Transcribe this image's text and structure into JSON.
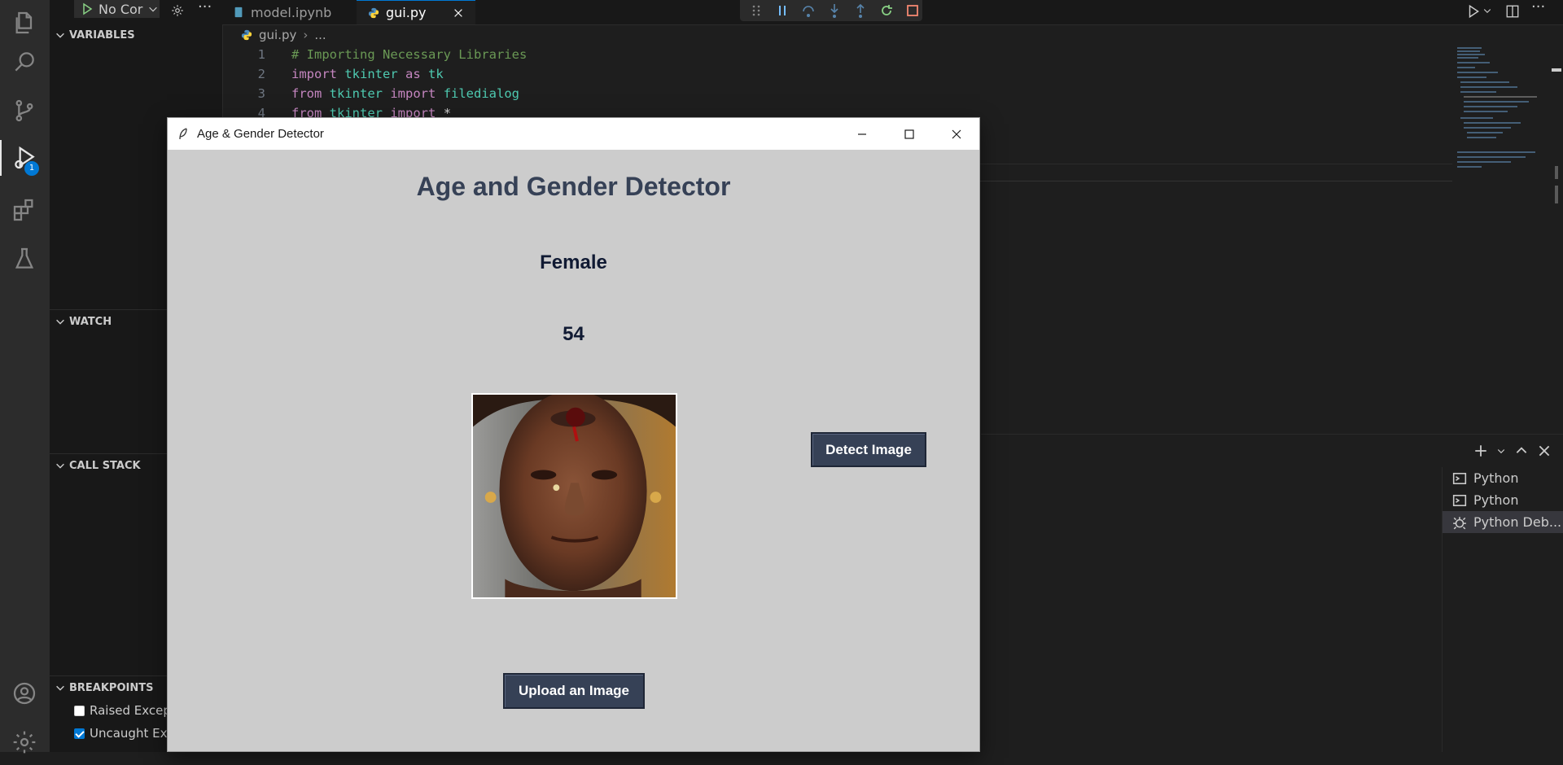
{
  "debug_toolbar": {
    "config_label": "No Cor"
  },
  "tabs": [
    {
      "label": "model.ipynb",
      "active": false
    },
    {
      "label": "gui.py",
      "active": true
    }
  ],
  "breadcrumbs": {
    "file": "gui.py",
    "more": "..."
  },
  "sidebar": {
    "variables_title": "VARIABLES",
    "watch_title": "WATCH",
    "call_stack_title": "CALL STACK",
    "breakpoints_title": "BREAKPOINTS",
    "breakpoints": [
      {
        "label": "Raised Excep",
        "checked": false
      },
      {
        "label": "Uncaught Exc",
        "checked": true
      }
    ]
  },
  "activity_bar": {
    "debug_badge": "1"
  },
  "editor": {
    "lines": [
      {
        "num": "1",
        "comment": "# Importing Necessary Libraries"
      },
      {
        "num": "2",
        "kw1": "import",
        "mod1": "tkinter",
        "kw2": "as",
        "mod2": "tk"
      },
      {
        "num": "3",
        "kw1": "from",
        "mod1": "tkinter",
        "kw2": "import",
        "mod2": "filedialog"
      },
      {
        "num": "4",
        "kw1": "from",
        "mod1": "tkinter",
        "kw2": "import",
        "rest": "*"
      }
    ]
  },
  "terminals": [
    {
      "label": "Python",
      "icon": "terminal-icon",
      "selected": false
    },
    {
      "label": "Python",
      "icon": "terminal-icon",
      "selected": false
    },
    {
      "label": "Python Deb...",
      "icon": "debug-icon",
      "selected": true
    }
  ],
  "app_window": {
    "title": "Age & Gender Detector",
    "heading": "Age and Gender Detector",
    "gender_result": "Female",
    "age_result": "54",
    "detect_button": "Detect Image",
    "upload_button": "Upload an Image",
    "colors": {
      "button_bg": "#364156",
      "heading": "#364156",
      "window_bg": "#cccccc"
    }
  }
}
